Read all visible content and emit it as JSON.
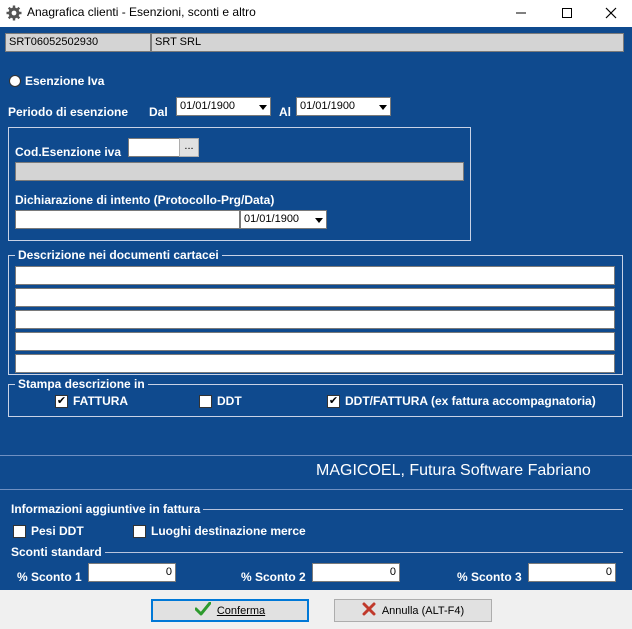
{
  "window": {
    "title": "Anagrafica clienti - Esenzioni, sconti e altro",
    "icon": "gear-icon"
  },
  "header": {
    "client_code": "SRT06052502930",
    "client_name": "SRT SRL"
  },
  "esenzione": {
    "radio_label": "Esenzione Iva",
    "periodo_label": "Periodo di esenzione",
    "dal_label": "Dal",
    "dal_value": "01/01/1900",
    "al_label": "Al",
    "al_value": "01/01/1900",
    "cod_label": "Cod.Esenzione iva",
    "cod_button": "...",
    "cod_value": "",
    "cod_description": "",
    "dichiarazione_label": "Dichiarazione di intento (Protocollo-Prg/Data)",
    "dichiarazione_value": "",
    "dichiarazione_date": "01/01/1900"
  },
  "descrizione": {
    "legend": "Descrizione nei documenti cartacei",
    "lines": [
      "",
      "",
      "",
      "",
      ""
    ]
  },
  "stampa": {
    "legend": "Stampa descrizione in",
    "options": [
      {
        "label": "FATTURA",
        "checked": true
      },
      {
        "label": "DDT",
        "checked": false
      },
      {
        "label": "DDT/FATTURA (ex fattura accompagnatoria)",
        "checked": true
      }
    ]
  },
  "brand": "MAGICOEL, Futura Software Fabriano",
  "info": {
    "legend": "Informazioni aggiuntive in fattura",
    "pesi_label": "Pesi DDT",
    "pesi_checked": false,
    "luoghi_label": "Luoghi destinazione merce",
    "luoghi_checked": false
  },
  "sconti": {
    "legend": "Sconti standard",
    "items": [
      {
        "label": "% Sconto 1",
        "value": "0"
      },
      {
        "label": "% Sconto 2",
        "value": "0"
      },
      {
        "label": "% Sconto 3",
        "value": "0"
      }
    ]
  },
  "buttons": {
    "confirm": "Conferma",
    "cancel": "Annulla (ALT-F4)"
  },
  "colors": {
    "form_background": "#0f4a8e",
    "confirm_icon": "#2e9a2e",
    "cancel_icon": "#c0392b"
  }
}
